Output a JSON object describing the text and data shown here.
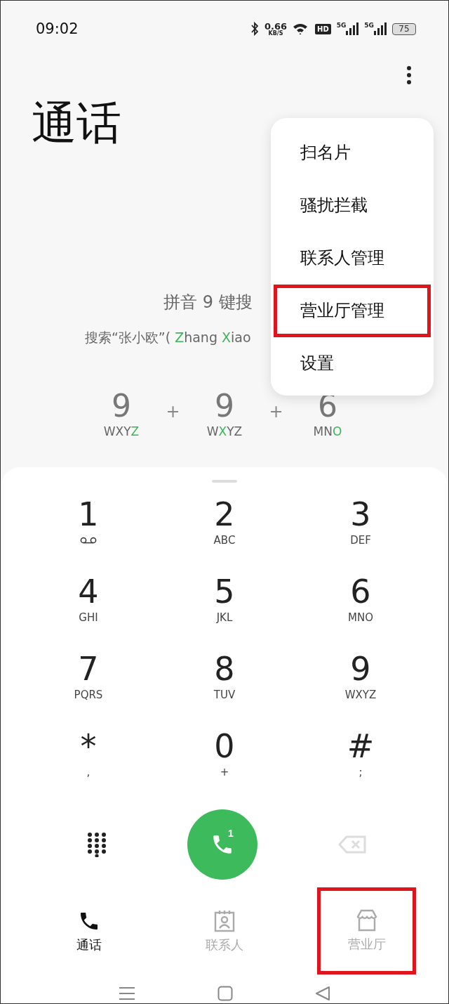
{
  "status_bar": {
    "time": "09:02",
    "speed": "0.66",
    "speed_unit": "KB/S",
    "hd_badge": "HD",
    "signals": [
      "5G",
      "5G"
    ],
    "battery": "75"
  },
  "title": "通话",
  "search_hint": {
    "title": "拼音 9 键搜",
    "example": [
      {
        "text": "搜索“张小欧”( ",
        "highlight": false
      },
      {
        "text": "Z",
        "highlight": true
      },
      {
        "text": "hang ",
        "highlight": false
      },
      {
        "text": "X",
        "highlight": true
      },
      {
        "text": "iao",
        "highlight": false
      }
    ],
    "keys": [
      {
        "digit": "9",
        "letters": [
          {
            "text": "WXY",
            "highlight": false
          },
          {
            "text": "Z",
            "highlight": true
          }
        ]
      },
      {
        "digit": "9",
        "letters": [
          {
            "text": "W",
            "highlight": false
          },
          {
            "text": "X",
            "highlight": true
          },
          {
            "text": "YZ",
            "highlight": false
          }
        ]
      },
      {
        "digit": "6",
        "letters": [
          {
            "text": "MN",
            "highlight": false
          },
          {
            "text": "O",
            "highlight": true
          }
        ]
      }
    ],
    "plus": [
      "+",
      "+"
    ]
  },
  "menu": [
    {
      "label": "扫名片",
      "highlight": false
    },
    {
      "label": "骚扰拦截",
      "highlight": false
    },
    {
      "label": "联系人管理",
      "highlight": false
    },
    {
      "label": "营业厅管理",
      "highlight": true
    },
    {
      "label": "设置",
      "highlight": false
    }
  ],
  "dialpad": [
    {
      "digit": "1",
      "kind": "voicemail"
    },
    {
      "digit": "2",
      "sub": "ABC",
      "kind": "letters"
    },
    {
      "digit": "3",
      "sub": "DEF",
      "kind": "letters"
    },
    {
      "digit": "4",
      "sub": "GHI",
      "kind": "letters"
    },
    {
      "digit": "5",
      "sub": "JKL",
      "kind": "letters"
    },
    {
      "digit": "6",
      "sub": "MNO",
      "kind": "letters"
    },
    {
      "digit": "7",
      "sub": "PQRS",
      "kind": "letters"
    },
    {
      "digit": "8",
      "sub": "TUV",
      "kind": "letters"
    },
    {
      "digit": "9",
      "sub": "WXYZ",
      "kind": "letters"
    },
    {
      "digit": "*",
      "sub": ",",
      "kind": "letters"
    },
    {
      "digit": "0",
      "sub": "+",
      "kind": "letters"
    },
    {
      "digit": "#",
      "sub": ";",
      "kind": "letters"
    }
  ],
  "call_button": {
    "sim": "1"
  },
  "tabs": [
    {
      "label": "通话",
      "selected": true,
      "highlight": false
    },
    {
      "label": "联系人",
      "selected": false,
      "highlight": false
    },
    {
      "label": "营业厅",
      "selected": false,
      "highlight": true
    }
  ]
}
